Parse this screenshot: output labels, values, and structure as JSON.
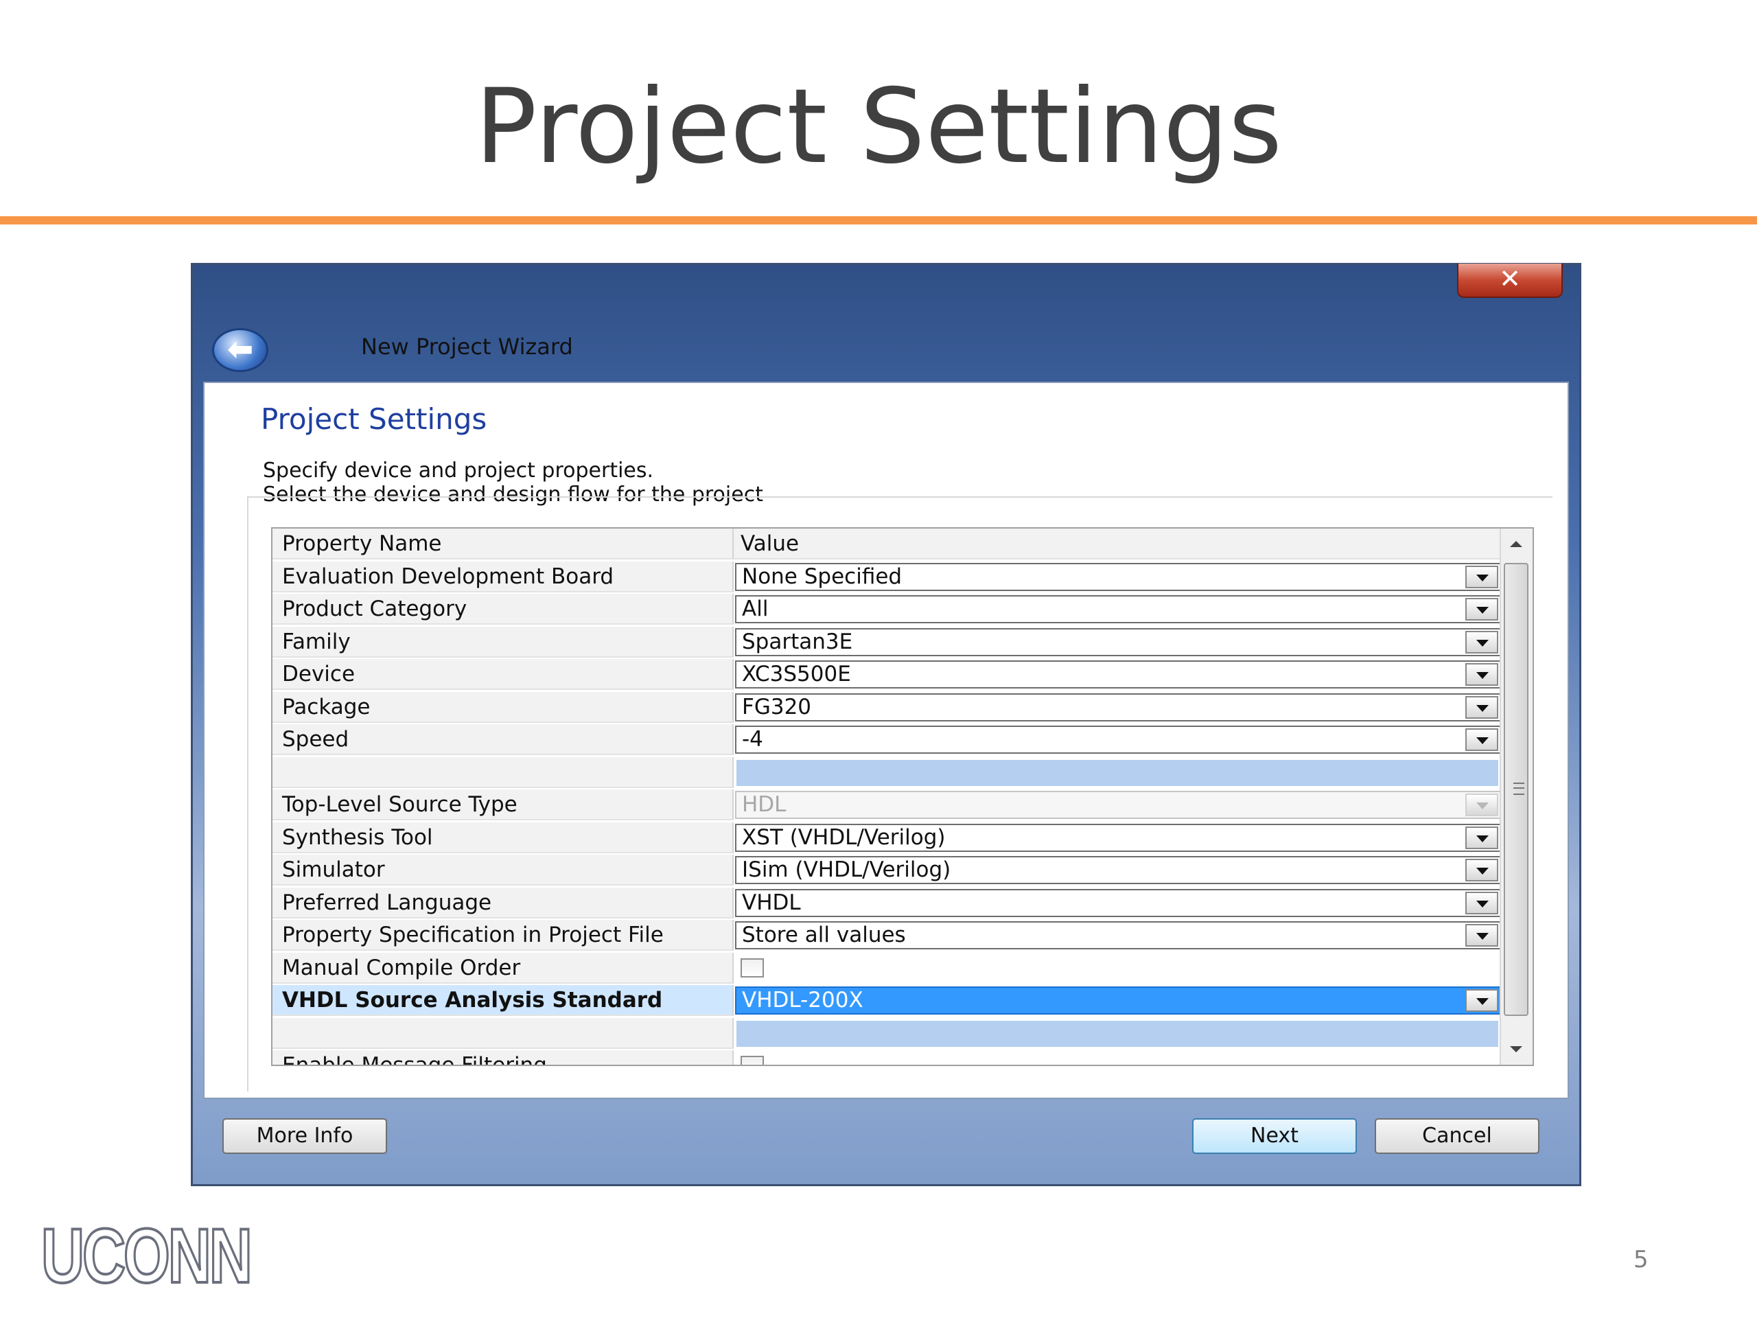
{
  "slide": {
    "title": "Project Settings",
    "page_number": "5",
    "logo_text": "UCONN",
    "accent_color": "#f79646"
  },
  "window": {
    "title": "New Project Wizard",
    "close_glyph": "✕",
    "back_glyph": "⬅",
    "page_heading": "Project Settings",
    "description_line1": "Specify device and project properties.",
    "description_line2": "Select the device and design flow for the project"
  },
  "grid": {
    "header": {
      "name": "Property Name",
      "value": "Value"
    },
    "rows": [
      {
        "name": "Evaluation Development Board",
        "value": "None Specified",
        "kind": "combo"
      },
      {
        "name": "Product Category",
        "value": "All",
        "kind": "combo"
      },
      {
        "name": "Family",
        "value": "Spartan3E",
        "kind": "combo"
      },
      {
        "name": "Device",
        "value": "XC3S500E",
        "kind": "combo"
      },
      {
        "name": "Package",
        "value": "FG320",
        "kind": "combo"
      },
      {
        "name": "Speed",
        "value": "-4",
        "kind": "combo"
      },
      {
        "name": "",
        "value": "",
        "kind": "spacer"
      },
      {
        "name": "Top-Level Source Type",
        "value": "HDL",
        "kind": "combo-disabled"
      },
      {
        "name": "Synthesis Tool",
        "value": "XST (VHDL/Verilog)",
        "kind": "combo"
      },
      {
        "name": "Simulator",
        "value": "ISim (VHDL/Verilog)",
        "kind": "combo"
      },
      {
        "name": "Preferred Language",
        "value": "VHDL",
        "kind": "combo"
      },
      {
        "name": "Property Specification in Project File",
        "value": "Store all values",
        "kind": "combo"
      },
      {
        "name": "Manual Compile Order",
        "value": "",
        "kind": "checkbox"
      },
      {
        "name": "VHDL Source Analysis Standard",
        "value": "VHDL-200X",
        "kind": "combo-selected"
      },
      {
        "name": "",
        "value": "",
        "kind": "spacer"
      },
      {
        "name": "Enable Message Filtering",
        "value": "",
        "kind": "checkbox"
      }
    ]
  },
  "buttons": {
    "more_info": "More Info",
    "next": "Next",
    "cancel": "Cancel"
  }
}
